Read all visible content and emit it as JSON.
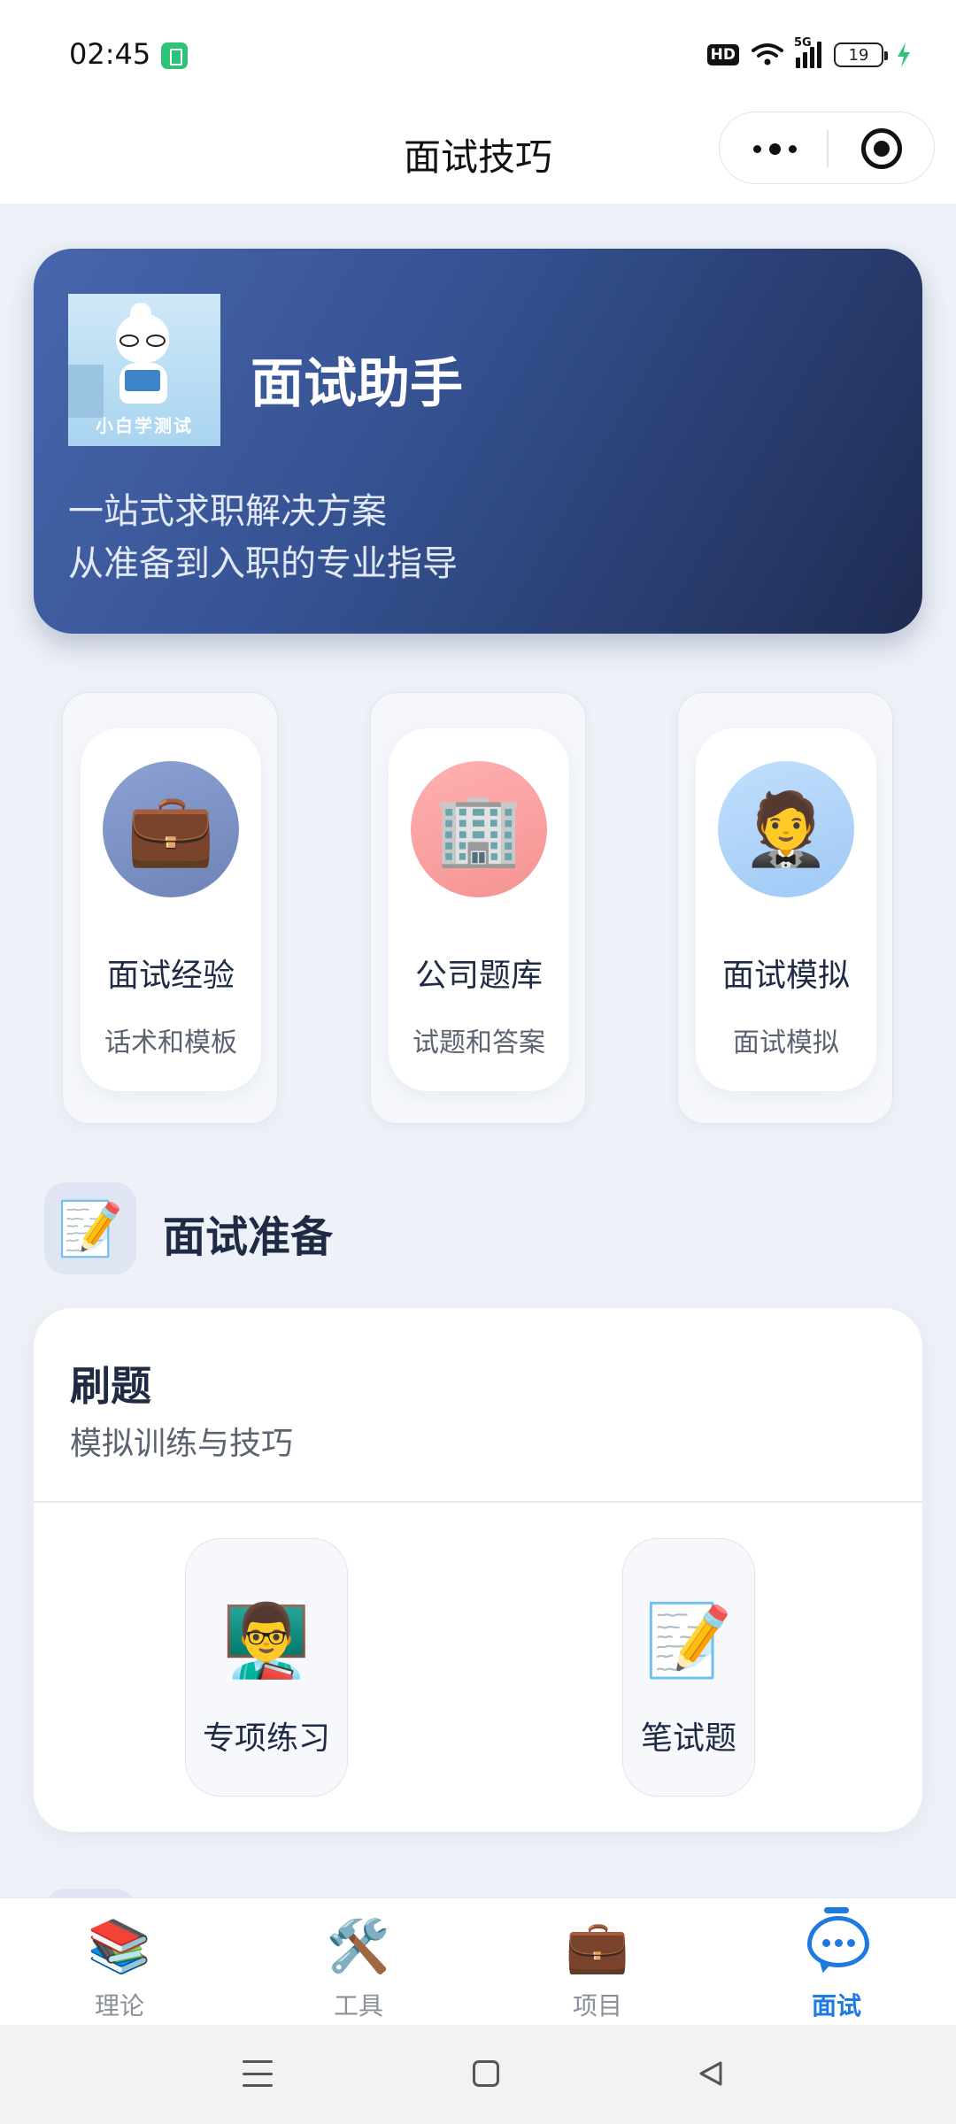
{
  "status_bar": {
    "time": "02:45",
    "hd_label": "HD",
    "network_label": "5G",
    "battery_level": "19"
  },
  "nav": {
    "title": "面试技巧",
    "more_icon": "more-dots-icon",
    "close_icon": "target-close-icon"
  },
  "hero": {
    "logo_text": "小白学测试",
    "title": "面试助手",
    "line1": "一站式求职解决方案",
    "line2": "从准备到入职的专业指导",
    "gradient": [
      "#4766ad",
      "#1f2c52"
    ]
  },
  "features": [
    {
      "icon": "💼",
      "title": "面试经验",
      "subtitle": "话术和模板",
      "color": "#8da2d3"
    },
    {
      "icon": "🏢",
      "title": "公司题库",
      "subtitle": "试题和答案",
      "color": "#fda4a4"
    },
    {
      "icon": "🤵",
      "title": "面试模拟",
      "subtitle": "面试模拟",
      "color": "#b4d6fa"
    }
  ],
  "section": {
    "icon": "📝",
    "title": "面试准备"
  },
  "practice": {
    "title": "刷题",
    "subtitle": "模拟训练与技巧",
    "buttons": [
      {
        "icon": "👨‍🏫",
        "label": "专项练习"
      },
      {
        "icon": "📝",
        "label": "笔试题"
      }
    ]
  },
  "tabbar": {
    "accent": "#1f7ae0",
    "items": [
      {
        "icon": "📚",
        "label": "理论"
      },
      {
        "icon": "🛠️",
        "label": "工具"
      },
      {
        "icon": "💼",
        "label": "项目"
      },
      {
        "icon": "chat-bubble-icon",
        "label": "面试",
        "active": true
      }
    ]
  }
}
